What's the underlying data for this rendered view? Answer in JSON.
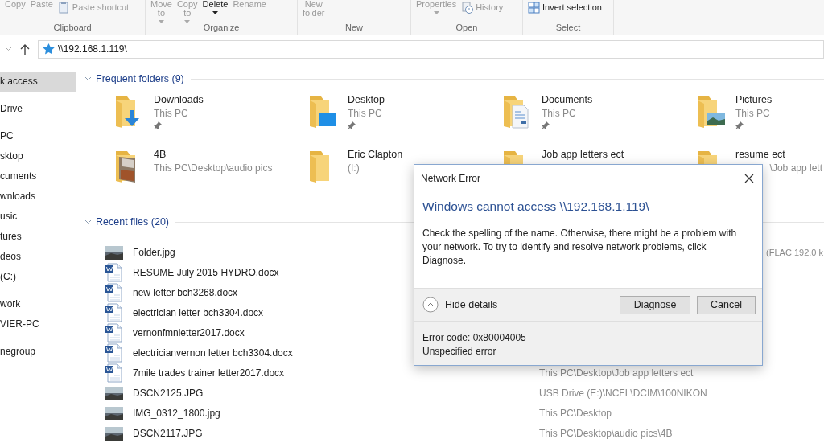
{
  "ribbon": {
    "groups": [
      {
        "label": "Clipboard",
        "buttons": [
          {
            "label": "Copy",
            "kind": "large",
            "caret": false,
            "disabled": true
          },
          {
            "label": "Paste",
            "kind": "large",
            "caret": false,
            "disabled": true
          },
          {
            "label": "Paste shortcut",
            "kind": "shortcut",
            "caret": false,
            "disabled": true
          }
        ]
      },
      {
        "label": "Organize",
        "buttons": [
          {
            "label": "Move to",
            "kind": "large",
            "caret": true,
            "disabled": true
          },
          {
            "label": "Copy to",
            "kind": "large",
            "caret": true,
            "disabled": true
          },
          {
            "label": "Delete",
            "kind": "large",
            "caret": true,
            "disabled": false
          },
          {
            "label": "Rename",
            "kind": "large",
            "caret": false,
            "disabled": true
          }
        ]
      },
      {
        "label": "New",
        "buttons": [
          {
            "label": "New folder",
            "kind": "large",
            "caret": false,
            "disabled": true
          }
        ]
      },
      {
        "label": "Open",
        "buttons": [
          {
            "label": "Properties",
            "kind": "large",
            "caret": true,
            "disabled": true
          },
          {
            "label": "History",
            "kind": "history",
            "caret": false,
            "disabled": true
          }
        ]
      },
      {
        "label": "Select",
        "buttons": [
          {
            "label": "Invert selection",
            "kind": "select",
            "caret": false,
            "disabled": false
          }
        ]
      }
    ]
  },
  "address_bar": {
    "path": "\\\\192.168.1.119\\"
  },
  "sidebar": {
    "sections": [
      {
        "items": [
          {
            "label": "k access",
            "selected": true
          }
        ]
      },
      {
        "items": [
          {
            "label": "Drive",
            "selected": false
          }
        ]
      },
      {
        "items": [
          {
            "label": "PC",
            "selected": false
          },
          {
            "label": "sktop",
            "selected": false
          },
          {
            "label": "cuments",
            "selected": false
          },
          {
            "label": "wnloads",
            "selected": false
          },
          {
            "label": "usic",
            "selected": false
          },
          {
            "label": "tures",
            "selected": false
          },
          {
            "label": "deos",
            "selected": false
          },
          {
            "label": "(C:)",
            "selected": false
          }
        ]
      },
      {
        "items": [
          {
            "label": "work",
            "selected": false
          },
          {
            "label": "VIER-PC",
            "selected": false
          }
        ]
      },
      {
        "items": [
          {
            "label": "negroup",
            "selected": false
          }
        ]
      }
    ]
  },
  "frequent_folders": {
    "title": "Frequent folders (9)",
    "expanded": true,
    "items": [
      {
        "name": "Downloads",
        "location": "This PC",
        "kind": "download",
        "pinned": true
      },
      {
        "name": "Desktop",
        "location": "This PC",
        "kind": "desktop",
        "pinned": true
      },
      {
        "name": "Documents",
        "location": "This PC",
        "kind": "document",
        "pinned": true
      },
      {
        "name": "Pictures",
        "location": "This PC",
        "kind": "picture",
        "pinned": true
      },
      {
        "name": "4B",
        "location": "This PC\\Desktop\\audio pics",
        "kind": "photo",
        "pinned": false
      },
      {
        "name": "Eric Clapton",
        "location": "(I:)",
        "kind": "plain",
        "pinned": false
      },
      {
        "name": "Job app letters ect",
        "kind": "plain",
        "pinned": false
      },
      {
        "name": "resume ect",
        "location_tail": "\\Job app lett",
        "kind": "plain",
        "pinned": false
      }
    ]
  },
  "recent_files": {
    "title": "Recent files (20)",
    "expanded": true,
    "items": [
      {
        "name": "Folder.jpg",
        "kind": "photo",
        "path_tail": "(FLAC 192.0 k"
      },
      {
        "name": "RESUME July 2015 HYDRO.docx",
        "kind": "word"
      },
      {
        "name": "new letter bch3268.docx",
        "kind": "word"
      },
      {
        "name": "electrician letter bch3304.docx",
        "kind": "word"
      },
      {
        "name": "vernonfmnletter2017.docx",
        "kind": "word"
      },
      {
        "name": "electricianvernon letter bch3304.docx",
        "kind": "word"
      },
      {
        "name": "7mile trades trainer letter2017.docx",
        "kind": "word",
        "path": "This PC\\Desktop\\Job app letters ect"
      },
      {
        "name": "DSCN2125.JPG",
        "kind": "photo",
        "path": "USB Drive (E:)\\NCFL\\DCIM\\100NIKON"
      },
      {
        "name": "IMG_0312_1800.jpg",
        "kind": "photo",
        "path": "This PC\\Desktop"
      },
      {
        "name": "DSCN2117.JPG",
        "kind": "photo",
        "path": "This PC\\Desktop\\audio pics\\4B"
      }
    ]
  },
  "dialog": {
    "title": "Network Error",
    "heading": "Windows cannot access \\\\192.168.1.119\\",
    "message": "Check the spelling of the name. Otherwise, there might be a problem with your network. To try to identify and resolve network problems, click Diagnose.",
    "details_expanded": true,
    "details_toggle": "Hide details",
    "buttons": [
      "Diagnose",
      "Cancel"
    ],
    "details": [
      "Error code: 0x80004005",
      "Unspecified error"
    ]
  }
}
